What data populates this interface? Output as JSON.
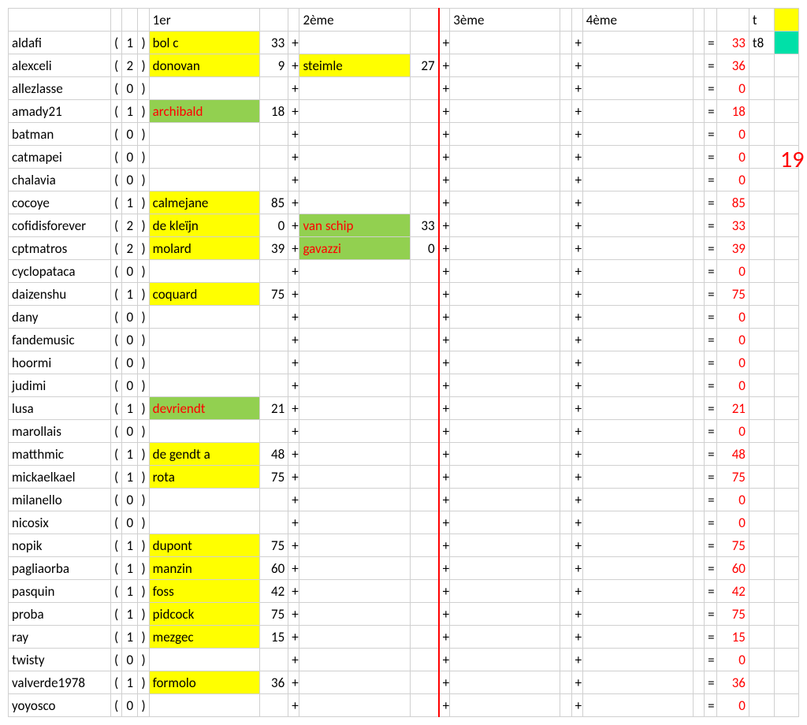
{
  "headers": {
    "c1": "1er",
    "c2": "2ème",
    "c3": "3ème",
    "c4": "4ème",
    "tot": "t"
  },
  "side_count": "19",
  "rows": [
    {
      "name": "aldafi",
      "count": 1,
      "r1": {
        "rider": "bol c",
        "pts": 33,
        "hl": "yellow"
      },
      "r2": null,
      "r3": null,
      "r4": null,
      "total": 33,
      "t": "t8",
      "x": "cyan"
    },
    {
      "name": "alexceli",
      "count": 2,
      "r1": {
        "rider": "donovan",
        "pts": 9,
        "hl": "yellow"
      },
      "r2": {
        "rider": "steimle",
        "pts": 27,
        "hl": "yellow"
      },
      "r3": null,
      "r4": null,
      "total": 36,
      "t": "",
      "x": ""
    },
    {
      "name": "allezlasse",
      "count": 0,
      "r1": null,
      "r2": null,
      "r3": null,
      "r4": null,
      "total": 0,
      "t": "",
      "x": ""
    },
    {
      "name": "amady21",
      "count": 1,
      "r1": {
        "rider": "archibald",
        "pts": 18,
        "hl": "green"
      },
      "r2": null,
      "r3": null,
      "r4": null,
      "total": 18,
      "t": "",
      "x": ""
    },
    {
      "name": "batman",
      "count": 0,
      "r1": null,
      "r2": null,
      "r3": null,
      "r4": null,
      "total": 0,
      "t": "",
      "x": ""
    },
    {
      "name": "catmapei",
      "count": 0,
      "r1": null,
      "r2": null,
      "r3": null,
      "r4": null,
      "total": 0,
      "t": "",
      "x": ""
    },
    {
      "name": "chalavia",
      "count": 0,
      "r1": null,
      "r2": null,
      "r3": null,
      "r4": null,
      "total": 0,
      "t": "",
      "x": ""
    },
    {
      "name": "cocoye",
      "count": 1,
      "r1": {
        "rider": "calmejane",
        "pts": 85,
        "hl": "yellow"
      },
      "r2": null,
      "r3": null,
      "r4": null,
      "total": 85,
      "t": "",
      "x": ""
    },
    {
      "name": "cofidisforever",
      "count": 2,
      "r1": {
        "rider": "de kleïjn",
        "pts": 0,
        "hl": "yellow"
      },
      "r2": {
        "rider": "van schip",
        "pts": 33,
        "hl": "green"
      },
      "r3": null,
      "r4": null,
      "total": 33,
      "t": "",
      "x": ""
    },
    {
      "name": "cptmatros",
      "count": 2,
      "r1": {
        "rider": "molard",
        "pts": 39,
        "hl": "yellow"
      },
      "r2": {
        "rider": "gavazzi",
        "pts": 0,
        "hl": "green"
      },
      "r3": null,
      "r4": null,
      "total": 39,
      "t": "",
      "x": ""
    },
    {
      "name": "cyclopataca",
      "count": 0,
      "r1": null,
      "r2": null,
      "r3": null,
      "r4": null,
      "total": 0,
      "t": "",
      "x": ""
    },
    {
      "name": "daizenshu",
      "count": 1,
      "r1": {
        "rider": "coquard",
        "pts": 75,
        "hl": "yellow"
      },
      "r2": null,
      "r3": null,
      "r4": null,
      "total": 75,
      "t": "",
      "x": ""
    },
    {
      "name": "dany",
      "count": 0,
      "r1": null,
      "r2": null,
      "r3": null,
      "r4": null,
      "total": 0,
      "t": "",
      "x": ""
    },
    {
      "name": "fandemusic",
      "count": 0,
      "r1": null,
      "r2": null,
      "r3": null,
      "r4": null,
      "total": 0,
      "t": "",
      "x": ""
    },
    {
      "name": "hoormi",
      "count": 0,
      "r1": null,
      "r2": null,
      "r3": null,
      "r4": null,
      "total": 0,
      "t": "",
      "x": ""
    },
    {
      "name": "judimi",
      "count": 0,
      "r1": null,
      "r2": null,
      "r3": null,
      "r4": null,
      "total": 0,
      "t": "",
      "x": ""
    },
    {
      "name": "lusa",
      "count": 1,
      "r1": {
        "rider": "devriendt",
        "pts": 21,
        "hl": "green"
      },
      "r2": null,
      "r3": null,
      "r4": null,
      "total": 21,
      "t": "",
      "x": ""
    },
    {
      "name": "marollais",
      "count": 0,
      "r1": null,
      "r2": null,
      "r3": null,
      "r4": null,
      "total": 0,
      "t": "",
      "x": ""
    },
    {
      "name": "matthmic",
      "count": 1,
      "r1": {
        "rider": "de gendt a",
        "pts": 48,
        "hl": "yellow"
      },
      "r2": null,
      "r3": null,
      "r4": null,
      "total": 48,
      "t": "",
      "x": ""
    },
    {
      "name": "mickaelkael",
      "count": 1,
      "r1": {
        "rider": "rota",
        "pts": 75,
        "hl": "yellow"
      },
      "r2": null,
      "r3": null,
      "r4": null,
      "total": 75,
      "t": "",
      "x": ""
    },
    {
      "name": "milanello",
      "count": 0,
      "r1": null,
      "r2": null,
      "r3": null,
      "r4": null,
      "total": 0,
      "t": "",
      "x": ""
    },
    {
      "name": "nicosix",
      "count": 0,
      "r1": null,
      "r2": null,
      "r3": null,
      "r4": null,
      "total": 0,
      "t": "",
      "x": ""
    },
    {
      "name": "nopik",
      "count": 1,
      "r1": {
        "rider": "dupont",
        "pts": 75,
        "hl": "yellow"
      },
      "r2": null,
      "r3": null,
      "r4": null,
      "total": 75,
      "t": "",
      "x": ""
    },
    {
      "name": "pagliaorba",
      "count": 1,
      "r1": {
        "rider": "manzin",
        "pts": 60,
        "hl": "yellow"
      },
      "r2": null,
      "r3": null,
      "r4": null,
      "total": 60,
      "t": "",
      "x": ""
    },
    {
      "name": "pasquin",
      "count": 1,
      "r1": {
        "rider": "foss",
        "pts": 42,
        "hl": "yellow"
      },
      "r2": null,
      "r3": null,
      "r4": null,
      "total": 42,
      "t": "",
      "x": ""
    },
    {
      "name": "proba",
      "count": 1,
      "r1": {
        "rider": "pidcock",
        "pts": 75,
        "hl": "yellow"
      },
      "r2": null,
      "r3": null,
      "r4": null,
      "total": 75,
      "t": "",
      "x": ""
    },
    {
      "name": "ray",
      "count": 1,
      "r1": {
        "rider": "mezgec",
        "pts": 15,
        "hl": "yellow"
      },
      "r2": null,
      "r3": null,
      "r4": null,
      "total": 15,
      "t": "",
      "x": ""
    },
    {
      "name": "twisty",
      "count": 0,
      "r1": null,
      "r2": null,
      "r3": null,
      "r4": null,
      "total": 0,
      "t": "",
      "x": ""
    },
    {
      "name": "valverde1978",
      "count": 1,
      "r1": {
        "rider": "formolo",
        "pts": 36,
        "hl": "yellow"
      },
      "r2": null,
      "r3": null,
      "r4": null,
      "total": 36,
      "t": "",
      "x": ""
    },
    {
      "name": "yoyosco",
      "count": 0,
      "r1": null,
      "r2": null,
      "r3": null,
      "r4": null,
      "total": 0,
      "t": "",
      "x": ""
    }
  ]
}
